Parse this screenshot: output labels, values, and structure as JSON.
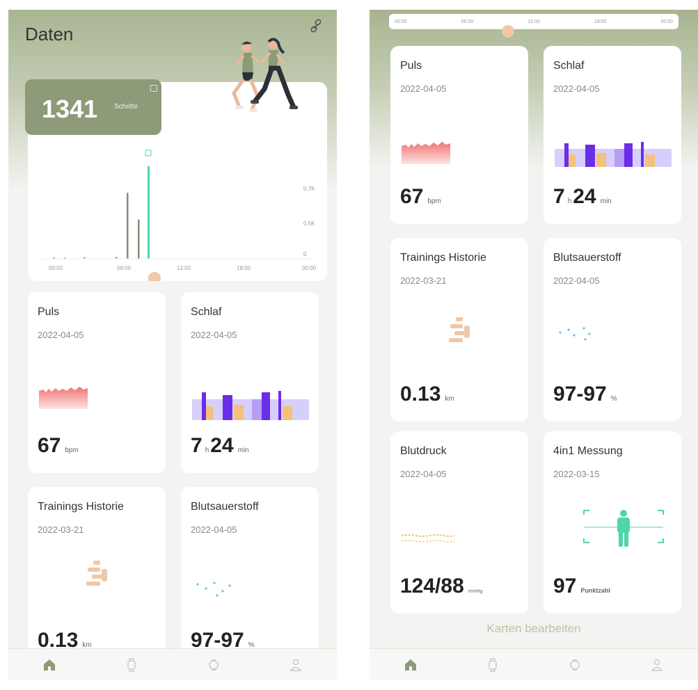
{
  "screen1": {
    "title": "Daten",
    "steps": {
      "value": "1341",
      "unit": "Schritte"
    },
    "chart_data": {
      "type": "bar",
      "x_ticks": [
        "00:00",
        "06:00",
        "12:00",
        "18:00",
        "00:00"
      ],
      "y_ticks": [
        "0.7K",
        "0.5K",
        "0"
      ],
      "values": [
        12,
        10,
        14,
        16,
        640,
        380,
        900
      ]
    },
    "cards": [
      {
        "title": "Puls",
        "date": "2022-04-05",
        "value": "67",
        "unit": "bpm"
      },
      {
        "title": "Schlaf",
        "date": "2022-04-05",
        "value_a": "7",
        "unit_a": "h",
        "value_b": "24",
        "unit_b": "min"
      },
      {
        "title": "Trainings Historie",
        "date": "2022-03-21",
        "value": "0.13",
        "unit": "km"
      },
      {
        "title": "Blutsauerstoff",
        "date": "2022-04-05",
        "value": "97-97",
        "unit": "%"
      }
    ]
  },
  "screen2": {
    "top_ticks": [
      "00:00",
      "06:00",
      "12:00",
      "18:00",
      "00:00"
    ],
    "cards": [
      {
        "title": "Puls",
        "date": "2022-04-05",
        "value": "67",
        "unit": "bpm"
      },
      {
        "title": "Schlaf",
        "date": "2022-04-05",
        "value_a": "7",
        "unit_a": "h",
        "value_b": "24",
        "unit_b": "min"
      },
      {
        "title": "Trainings Historie",
        "date": "2022-03-21",
        "value": "0.13",
        "unit": "km"
      },
      {
        "title": "Blutsauerstoff",
        "date": "2022-04-05",
        "value": "97-97",
        "unit": "%"
      },
      {
        "title": "Blutdruck",
        "date": "2022-04-05",
        "value": "124/88",
        "unit": "mmHg"
      },
      {
        "title": "4in1 Messung",
        "date": "2022-03-15",
        "value": "97",
        "unit": "Punktzahl"
      }
    ],
    "edit_label": "Karten bearbeiten"
  },
  "tabs": [
    "home-icon",
    "watch-icon",
    "device-icon",
    "profile-icon"
  ],
  "colors": {
    "brand": "#8d9b78",
    "accent_green": "#4fd6a6",
    "purple": "#6a2ee8",
    "orange": "#f2c27a"
  }
}
